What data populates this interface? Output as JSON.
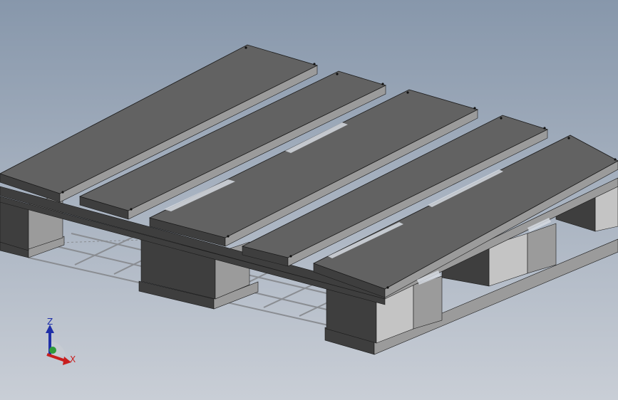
{
  "viewport": {
    "background_top": "#8797ab",
    "background_bottom": "#c9ced6"
  },
  "model": {
    "top_face_color": "#626262",
    "side_face_color": "#9b9b9b",
    "end_face_color": "#c4c4c4",
    "dark_face_color": "#3e3e3e",
    "edge_color": "#1a1a1a",
    "floor_grid_color": "#8a8d92"
  },
  "triad": {
    "z_label": "Z",
    "x_label": "X",
    "z_color": "#1f2fa8",
    "x_color": "#c81e1e",
    "origin_color": "#2f9a3a"
  }
}
